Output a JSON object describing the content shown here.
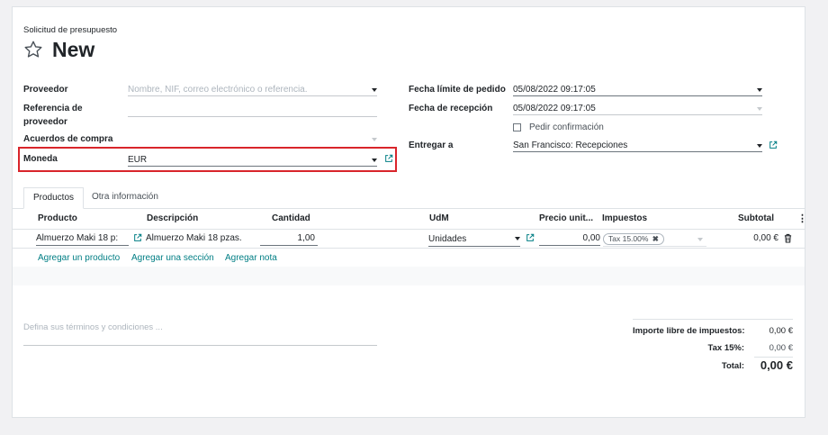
{
  "header": {
    "breadcrumb": "Solicitud de presupuesto",
    "title": "New"
  },
  "form": {
    "left": {
      "vendor_label": "Proveedor",
      "vendor_placeholder": "Nombre, NIF, correo electrónico o referencia.",
      "vendor_ref_label_1": "Referencia de",
      "vendor_ref_label_2": "proveedor",
      "agreement_label": "Acuerdos de compra",
      "currency_label": "Moneda",
      "currency_value": "EUR"
    },
    "right": {
      "order_deadline_label": "Fecha límite de pedido",
      "order_deadline_value": "05/08/2022 09:17:05",
      "receipt_date_label": "Fecha de recepción",
      "receipt_date_value": "05/08/2022 09:17:05",
      "ask_confirmation_label": "Pedir confirmación",
      "deliver_to_label": "Entregar a",
      "deliver_to_value": "San Francisco: Recepciones"
    }
  },
  "tabs": [
    "Productos",
    "Otra información"
  ],
  "table": {
    "headers": {
      "product": "Producto",
      "description": "Descripción",
      "quantity": "Cantidad",
      "uom": "UdM",
      "unit_price": "Precio unit...",
      "taxes": "Impuestos",
      "subtotal": "Subtotal"
    },
    "row": {
      "product": "Almuerzo Maki 18 p:",
      "description": "Almuerzo Maki 18 pzas.",
      "quantity": "1,00",
      "uom": "Unidades",
      "unit_price": "0,00",
      "tax_tag": "Tax 15.00%",
      "subtotal": "0,00 €"
    },
    "links": {
      "add_product": "Agregar un producto",
      "add_section": "Agregar una sección",
      "add_note": "Agregar nota"
    }
  },
  "footer": {
    "terms_placeholder": "Defina sus términos y condiciones ...",
    "untaxed_label": "Importe libre de impuestos:",
    "untaxed_value": "0,00 €",
    "tax_label": "Tax 15%:",
    "tax_value": "0,00 €",
    "total_label": "Total:",
    "total_value": "0,00 €"
  },
  "colors": {
    "accent": "#017e84",
    "highlight": "#d9252b"
  }
}
